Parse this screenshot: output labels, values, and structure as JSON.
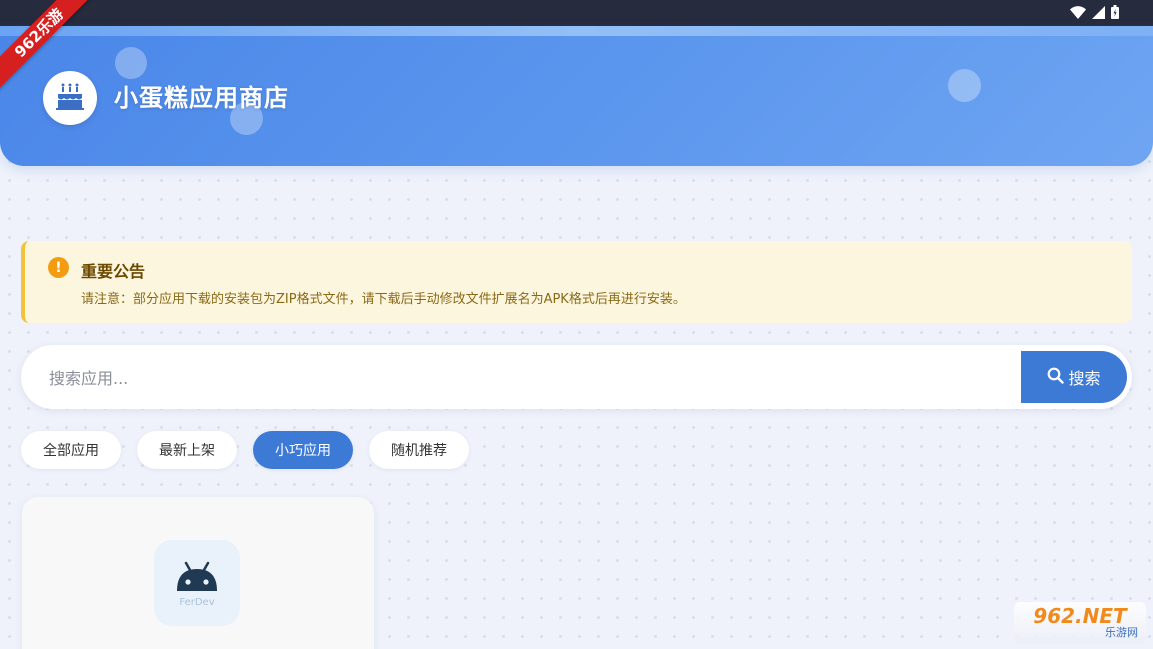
{
  "status_bar": {
    "icons": [
      "wifi-icon",
      "cellular-signal-icon",
      "battery-icon"
    ]
  },
  "corner_ribbon": {
    "text": "962乐游"
  },
  "header": {
    "title": "小蛋糕应用商店",
    "logo_icon": "cake-icon"
  },
  "notice": {
    "icon": "exclamation-icon",
    "title": "重要公告",
    "text": "请注意：部分应用下载的安装包为ZIP格式文件，请下载后手动修改文件扩展名为APK格式后再进行安装。"
  },
  "search": {
    "placeholder": "搜索应用...",
    "value": "",
    "button_label": "搜索",
    "button_icon": "search-icon"
  },
  "tabs": [
    {
      "label": "全部应用",
      "active": false
    },
    {
      "label": "最新上架",
      "active": false
    },
    {
      "label": "小巧应用",
      "active": true
    },
    {
      "label": "随机推荐",
      "active": false
    }
  ],
  "app_card": {
    "icon": "android-icon",
    "icon_text": "FerDev"
  },
  "watermark": {
    "brand": "962.NET",
    "sub": "乐游网"
  },
  "colors": {
    "header_gradient_start": "#4a86e8",
    "header_gradient_end": "#6fa5f2",
    "accent": "#3d7ad6",
    "notice_bg": "#fdf6df",
    "notice_border": "#f2c23a",
    "notice_icon": "#f39c12",
    "ribbon": "#d61f1f"
  }
}
